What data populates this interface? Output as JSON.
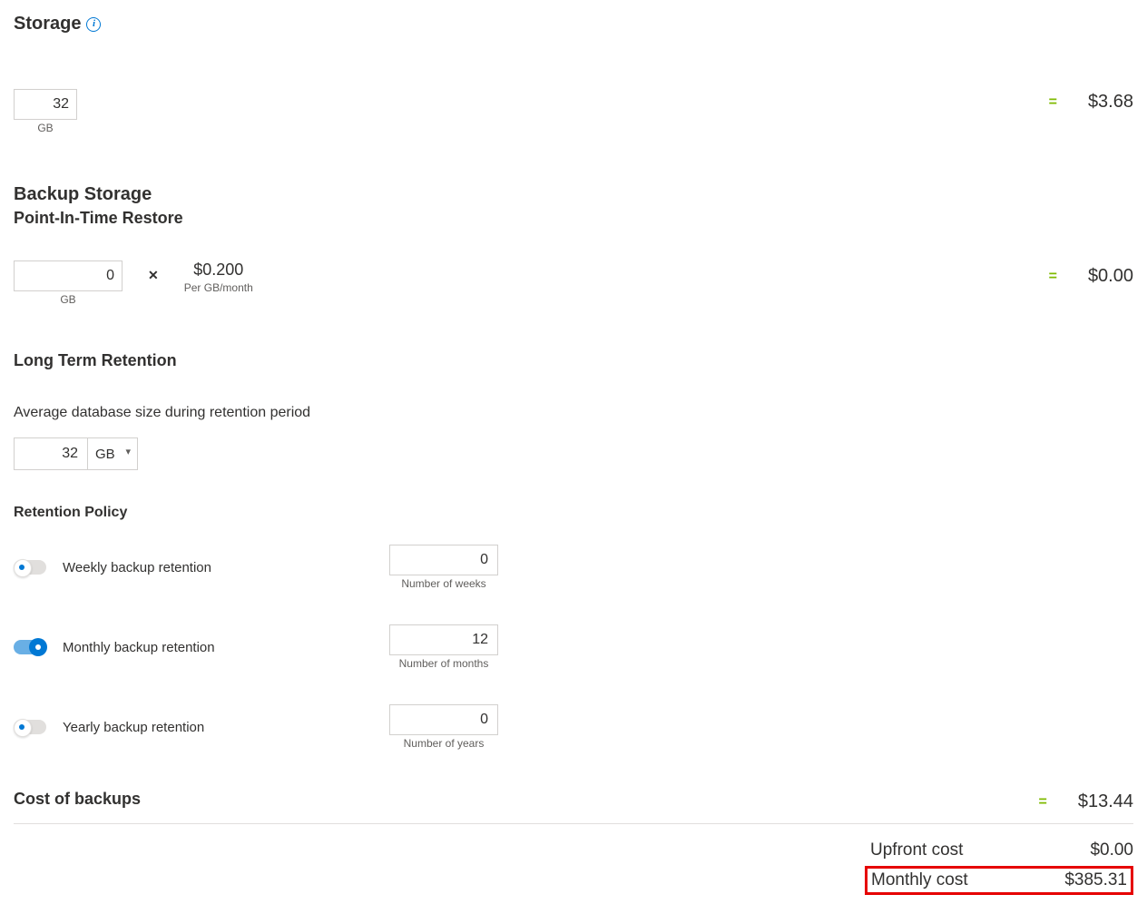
{
  "storage": {
    "title": "Storage",
    "value": "32",
    "unit": "GB",
    "cost": "$3.68"
  },
  "backup": {
    "title": "Backup Storage",
    "subtitle": "Point-In-Time Restore",
    "value": "0",
    "unit": "GB",
    "rate": "$0.200",
    "rate_label": "Per GB/month",
    "cost": "$0.00"
  },
  "ltr": {
    "title": "Long Term Retention",
    "avg_label": "Average database size during retention period",
    "avg_value": "32",
    "avg_unit": "GB",
    "policy_title": "Retention Policy",
    "weekly": {
      "label": "Weekly backup retention",
      "value": "0",
      "sub": "Number of weeks"
    },
    "monthly": {
      "label": "Monthly backup retention",
      "value": "12",
      "sub": "Number of months"
    },
    "yearly": {
      "label": "Yearly backup retention",
      "value": "0",
      "sub": "Number of years"
    }
  },
  "cost_backups": {
    "title": "Cost of backups",
    "value": "$13.44"
  },
  "summary": {
    "upfront_label": "Upfront cost",
    "upfront_value": "$0.00",
    "monthly_label": "Monthly cost",
    "monthly_value": "$385.31"
  },
  "eq": "="
}
